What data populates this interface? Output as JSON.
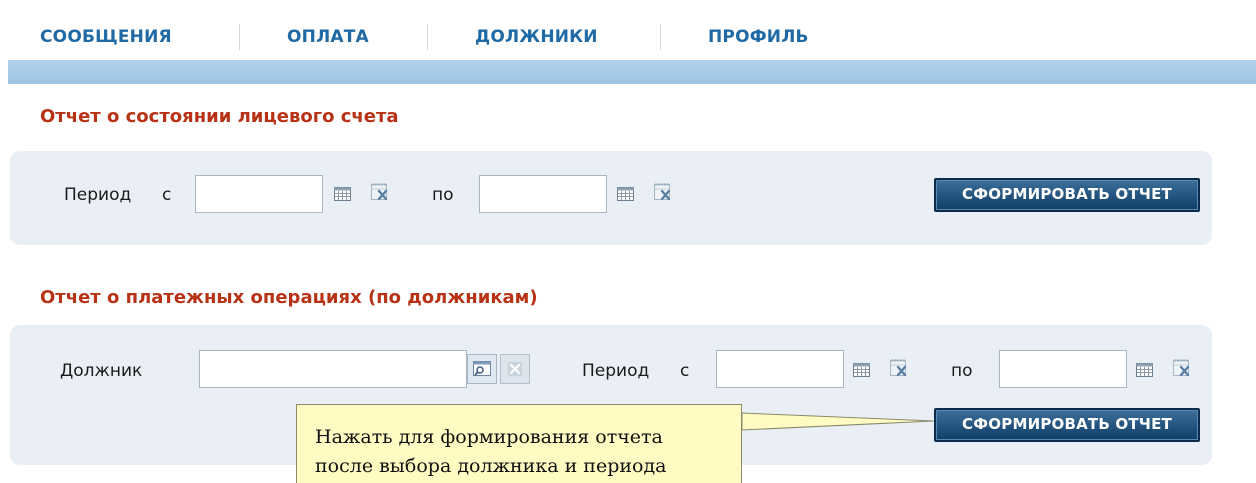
{
  "nav": {
    "items": [
      {
        "label": "СООБЩЕНИЯ"
      },
      {
        "label": "ОПЛАТА"
      },
      {
        "label": "ДОЛЖНИКИ"
      },
      {
        "label": "ПРОФИЛЬ"
      }
    ]
  },
  "account_report": {
    "title": "Отчет о состоянии лицевого счета",
    "period_label": "Период",
    "from_label": "с",
    "to_label": "по",
    "date_from_value": "",
    "date_to_value": "",
    "button_label": "СФОРМИРОВАТЬ ОТЧЕТ"
  },
  "payments_report": {
    "title": "Отчет о платежных операциях (по должникам)",
    "debtor_label": "Должник",
    "debtor_value": "",
    "period_label": "Период",
    "from_label": "с",
    "to_label": "по",
    "date_from_value": "",
    "date_to_value": "",
    "button_label": "СФОРМИРОВАТЬ ОТЧЕТ"
  },
  "callout": {
    "line1": "Нажать для формирования отчета",
    "line2": "после выбора должника и периода"
  },
  "colors": {
    "nav_text": "#1f6aa5",
    "section_title": "#b83216",
    "panel_bg": "#e9eff5",
    "button_bg": "#1b4a75",
    "callout_bg": "#fffbc2"
  },
  "icons": [
    "calendar-icon",
    "clear-date-icon",
    "lookup-icon",
    "clear-lookup-icon"
  ]
}
